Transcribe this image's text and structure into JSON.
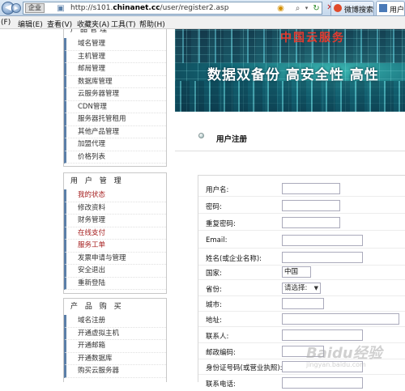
{
  "browser": {
    "site_tag": "企业",
    "url_prefix": "http://s101.",
    "url_domain": "chinanet.cc",
    "url_path": "/user/register2.asp",
    "tabs": [
      {
        "label": "微博搜索 - ..."
      },
      {
        "label": "用户..."
      }
    ]
  },
  "menu": [
    "(F)",
    "编辑(E)",
    "查看(V)",
    "收藏夹(A)",
    "工具(T)",
    "帮助(H)"
  ],
  "sidebar": {
    "box1": {
      "head": "产品管理",
      "items": [
        {
          "label": "域名管理"
        },
        {
          "label": "主机管理"
        },
        {
          "label": "邮局管理"
        },
        {
          "label": "数据库管理"
        },
        {
          "label": "云服务器管理"
        },
        {
          "label": "CDN管理"
        },
        {
          "label": "服务器托管租用"
        },
        {
          "label": "其他产品管理"
        },
        {
          "label": "加盟代理"
        },
        {
          "label": "价格列表"
        }
      ]
    },
    "box2": {
      "head": "用 户 管 理",
      "items": [
        {
          "label": "我的状态"
        },
        {
          "label": "修改资料"
        },
        {
          "label": "财务管理"
        },
        {
          "label": "在线支付"
        },
        {
          "label": "服务工单"
        },
        {
          "label": "发票申请与管理"
        },
        {
          "label": "安全退出"
        },
        {
          "label": "重新登陆"
        }
      ]
    },
    "box3": {
      "head": "产 品 购 买",
      "items": [
        {
          "label": "域名注册"
        },
        {
          "label": "开通虚拟主机"
        },
        {
          "label": "开通邮箱"
        },
        {
          "label": "开通数据库"
        },
        {
          "label": "购买云服务器"
        }
      ]
    }
  },
  "banner": {
    "top_text": "中国云服务",
    "slogan": "数据双备份 高安全性 高性"
  },
  "page": {
    "title": "用户注册"
  },
  "form": {
    "username": {
      "label": "用户名:",
      "value": ""
    },
    "password": {
      "label": "密码:",
      "value": ""
    },
    "password_confirm": {
      "label": "重复密码:",
      "value": ""
    },
    "email": {
      "label": "Email:",
      "value": ""
    },
    "name": {
      "label": "姓名(或企业名称):",
      "value": ""
    },
    "country": {
      "label": "国家:",
      "value": "中国"
    },
    "province": {
      "label": "省份:",
      "selected": "请选择:"
    },
    "city": {
      "label": "城市:",
      "value": ""
    },
    "address": {
      "label": "地址:",
      "value": ""
    },
    "contact": {
      "label": "联系人:",
      "value": ""
    },
    "postcode": {
      "label": "邮政编码:",
      "value": ""
    },
    "id_number": {
      "label": "身份证号码(或营业执照):",
      "value": ""
    },
    "phone": {
      "label": "联系电话:",
      "value": ""
    }
  },
  "watermark": {
    "main": "Baidu经验",
    "sub": "jingyan.baidu.com"
  }
}
